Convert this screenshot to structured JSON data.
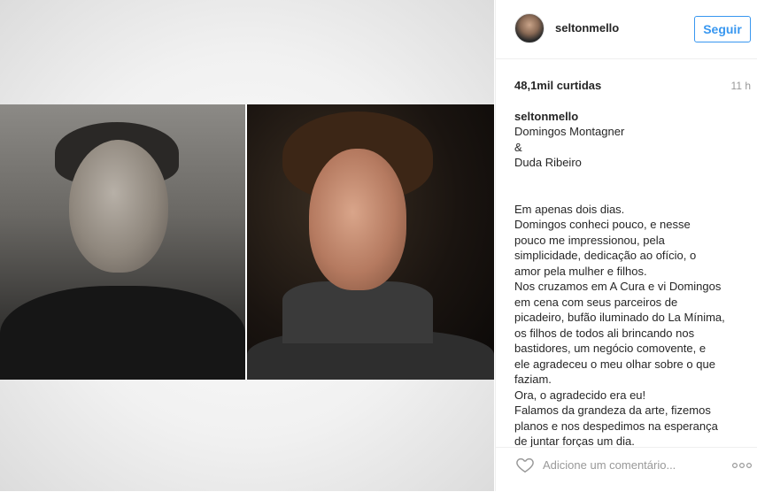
{
  "post": {
    "username": "seltonmello",
    "follow_label": "Seguir",
    "likes": "48,1mil curtidas",
    "time_ago": "11 h",
    "caption_author": "seltonmello",
    "caption_lines_1": [
      "Domingos Montagner",
      "&",
      "Duda Ribeiro"
    ],
    "caption_lines_2": [
      "Em apenas dois dias.",
      "Domingos conheci pouco, e nesse",
      "pouco me impressionou, pela",
      "simplicidade, dedicação ao ofício, o",
      "amor pela mulher e filhos.",
      "Nos cruzamos em A Cura e vi Domingos",
      "em cena com seus parceiros de",
      "picadeiro, bufão iluminado do La Mínima,",
      "os filhos de todos ali brincando nos",
      "bastidores, um negócio comovente, e",
      "ele agradeceu o meu olhar sobre o que",
      "faziam.",
      "Ora, o agradecido era eu!",
      "Falamos da grandeza da arte, fizemos",
      "planos e nos despedimos na esperança",
      "de juntar forças um dia."
    ],
    "comment_placeholder": "Adicione um comentário...",
    "icons": {
      "like": "heart-icon",
      "more": "more-options-icon",
      "avatar": "avatar"
    },
    "colors": {
      "accent": "#3897f0",
      "text": "#262626",
      "muted": "#999999",
      "divider": "#efefef"
    }
  }
}
